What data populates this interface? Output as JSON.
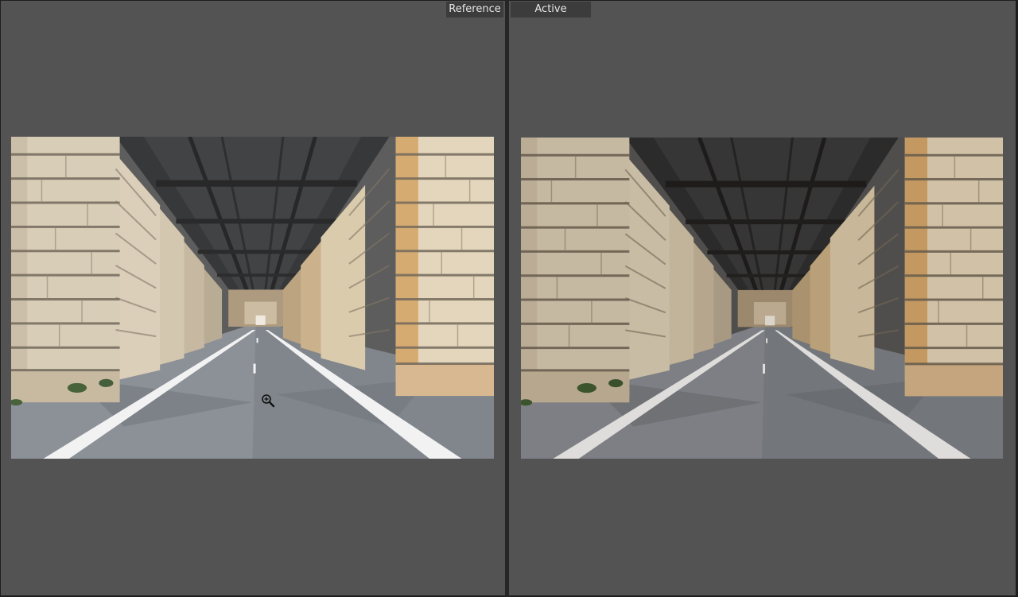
{
  "panes": {
    "reference": {
      "label": "Reference"
    },
    "active": {
      "label": "Active"
    }
  },
  "icons": {
    "cursor": "zoom-in-cursor-icon"
  },
  "colors": {
    "pane_background": "#535353",
    "label_background": "#3c3c3c",
    "divider": "#262626"
  }
}
